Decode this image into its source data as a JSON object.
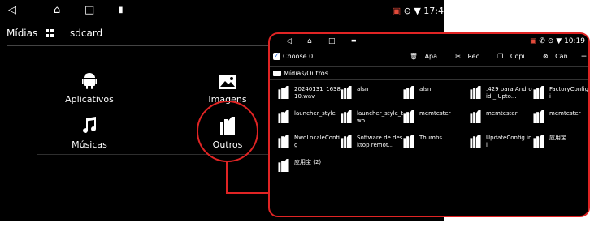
{
  "back_screen": {
    "status_bar": {
      "right": "17:4",
      "battery_glyph": "▣"
    },
    "toolbar": {
      "title": "Mídias",
      "location": "sdcard"
    },
    "apps": [
      {
        "label": "Aplicativos",
        "icon": "android-icon"
      },
      {
        "label": "Imagens",
        "icon": "image-icon"
      },
      {
        "label": "Músicas",
        "icon": "music-note-icon"
      },
      {
        "label": "Outros",
        "icon": "files-icon"
      }
    ]
  },
  "front_screen": {
    "status_bar": {
      "time": "10:19"
    },
    "action_bar": {
      "choose": "Choose 0",
      "actions": [
        "Apa...",
        "Rec...",
        "Copi...",
        "Can..."
      ]
    },
    "path": "Mídias/Outros",
    "files": [
      "20240131_163810.wav",
      "alsn",
      "alsn",
      ".429 para Android _ Upto...",
      "FactoryConfig.ini",
      "launcher_style",
      "launcher_style_two",
      "memtester",
      "memtester",
      "memtester",
      "NwdLocaleConfig",
      "Software de desktop remot...",
      "Thumbs",
      "UpdateConfig.ini",
      "应用宝",
      "应用宝 (2)"
    ]
  },
  "colors": {
    "highlight": "#e02424",
    "background": "#000000",
    "text": "#ffffff"
  }
}
